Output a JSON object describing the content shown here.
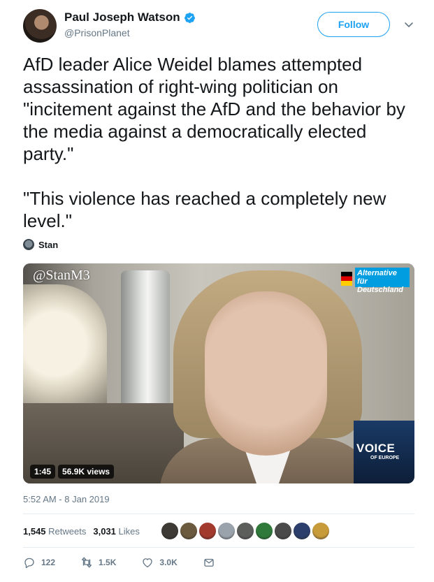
{
  "author": {
    "name": "Paul Joseph Watson",
    "handle": "@PrisonPlanet",
    "verified": true
  },
  "follow_label": "Follow",
  "tweet": {
    "text": "AfD leader Alice Weidel blames attempted assassination of right-wing politician on \"incitement against the AfD and the behavior by the media against a democratically elected party.\"\n\n\"This violence has reached a completely new level.\""
  },
  "attribution": {
    "name": "Stan"
  },
  "video": {
    "watermark": "@StanM3",
    "duration": "1:45",
    "views": "56.9K views",
    "afd_logo_text": "Alternative für Deutschland",
    "voe_title": "VOICE",
    "voe_subtitle": "OF EUROPE"
  },
  "timestamp": "5:52 AM - 8 Jan 2019",
  "stats": {
    "retweets_count": "1,545",
    "retweets_label": "Retweets",
    "likes_count": "3,031",
    "likes_label": "Likes"
  },
  "likers_colors": [
    "#3d3a35",
    "#6b5a3e",
    "#a33a2e",
    "#9aa3ab",
    "#5c5e5c",
    "#2f7a3a",
    "#4a4a4a",
    "#2c3e6b",
    "#c79a3a"
  ],
  "actions": {
    "replies": "122",
    "retweets": "1.5K",
    "likes": "3.0K"
  },
  "colors": {
    "accent": "#1da1f2",
    "secondary_text": "#657786",
    "primary_text": "#14171a"
  },
  "icons": [
    "verified-badge-icon",
    "chevron-down-icon",
    "reply-icon",
    "retweet-icon",
    "like-icon",
    "direct-message-icon"
  ]
}
